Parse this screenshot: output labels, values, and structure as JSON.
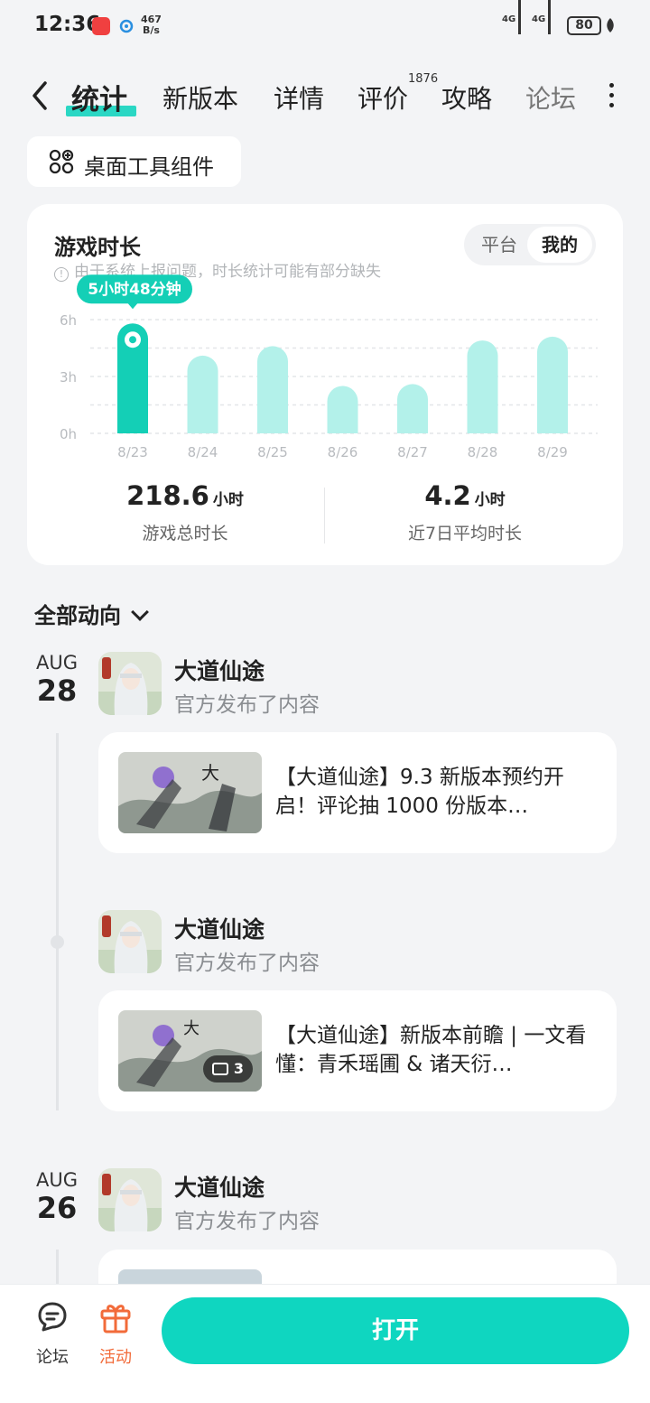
{
  "status_bar": {
    "time": "12:36",
    "speed_value": "467",
    "speed_unit": "B/s",
    "network_1": "4G",
    "network_2": "4G",
    "battery": "80"
  },
  "nav": {
    "tabs": [
      {
        "label": "统计",
        "active": true
      },
      {
        "label": "新版本"
      },
      {
        "label": "详情"
      },
      {
        "label": "评价",
        "badge": "1876"
      },
      {
        "label": "攻略"
      },
      {
        "label": "论坛"
      }
    ]
  },
  "widget_chip": {
    "label": "桌面工具组件"
  },
  "stats_card": {
    "title": "游戏时长",
    "note": "由于系统上报问题，时长统计可能有部分缺失",
    "toggle": {
      "platform": "平台",
      "mine": "我的",
      "selected": "mine"
    },
    "tooltip": "5小时48分钟",
    "total": {
      "value": "218.6",
      "unit": "小时",
      "label": "游戏总时长"
    },
    "average": {
      "value": "4.2",
      "unit": "小时",
      "label": "近7日平均时长"
    }
  },
  "chart_data": {
    "type": "bar",
    "categories": [
      "8/23",
      "8/24",
      "8/25",
      "8/26",
      "8/27",
      "8/28",
      "8/29"
    ],
    "values": [
      5.8,
      4.1,
      4.6,
      2.5,
      2.6,
      4.9,
      5.1
    ],
    "highlighted_index": 0,
    "yticks": [
      "6h",
      "3h",
      "0h"
    ],
    "ylim": [
      0,
      6
    ],
    "grid": true,
    "colors": {
      "highlight": "#14cfb6",
      "normal": "#b3f1ea"
    }
  },
  "activity": {
    "filter_label": "全部动向",
    "groups": [
      {
        "month": "AUG",
        "day": "28",
        "posts": [
          {
            "game": "大道仙途",
            "subtitle": "官方发布了内容",
            "text": "【大道仙途】9.3 新版本预约开启！评论抽 1000 份版本…"
          },
          {
            "game": "大道仙途",
            "subtitle": "官方发布了内容",
            "text": "【大道仙途】新版本前瞻 | 一文看懂：青禾瑶圃 & 诸天衍…",
            "image_count": "3"
          }
        ]
      },
      {
        "month": "AUG",
        "day": "26",
        "posts": [
          {
            "game": "大道仙途",
            "subtitle": "官方发布了内容"
          }
        ]
      }
    ]
  },
  "bottom_bar": {
    "forum_label": "论坛",
    "event_label": "活动",
    "open_label": "打开",
    "accent": "#0fd6c0",
    "event_color": "#f26b3a"
  }
}
